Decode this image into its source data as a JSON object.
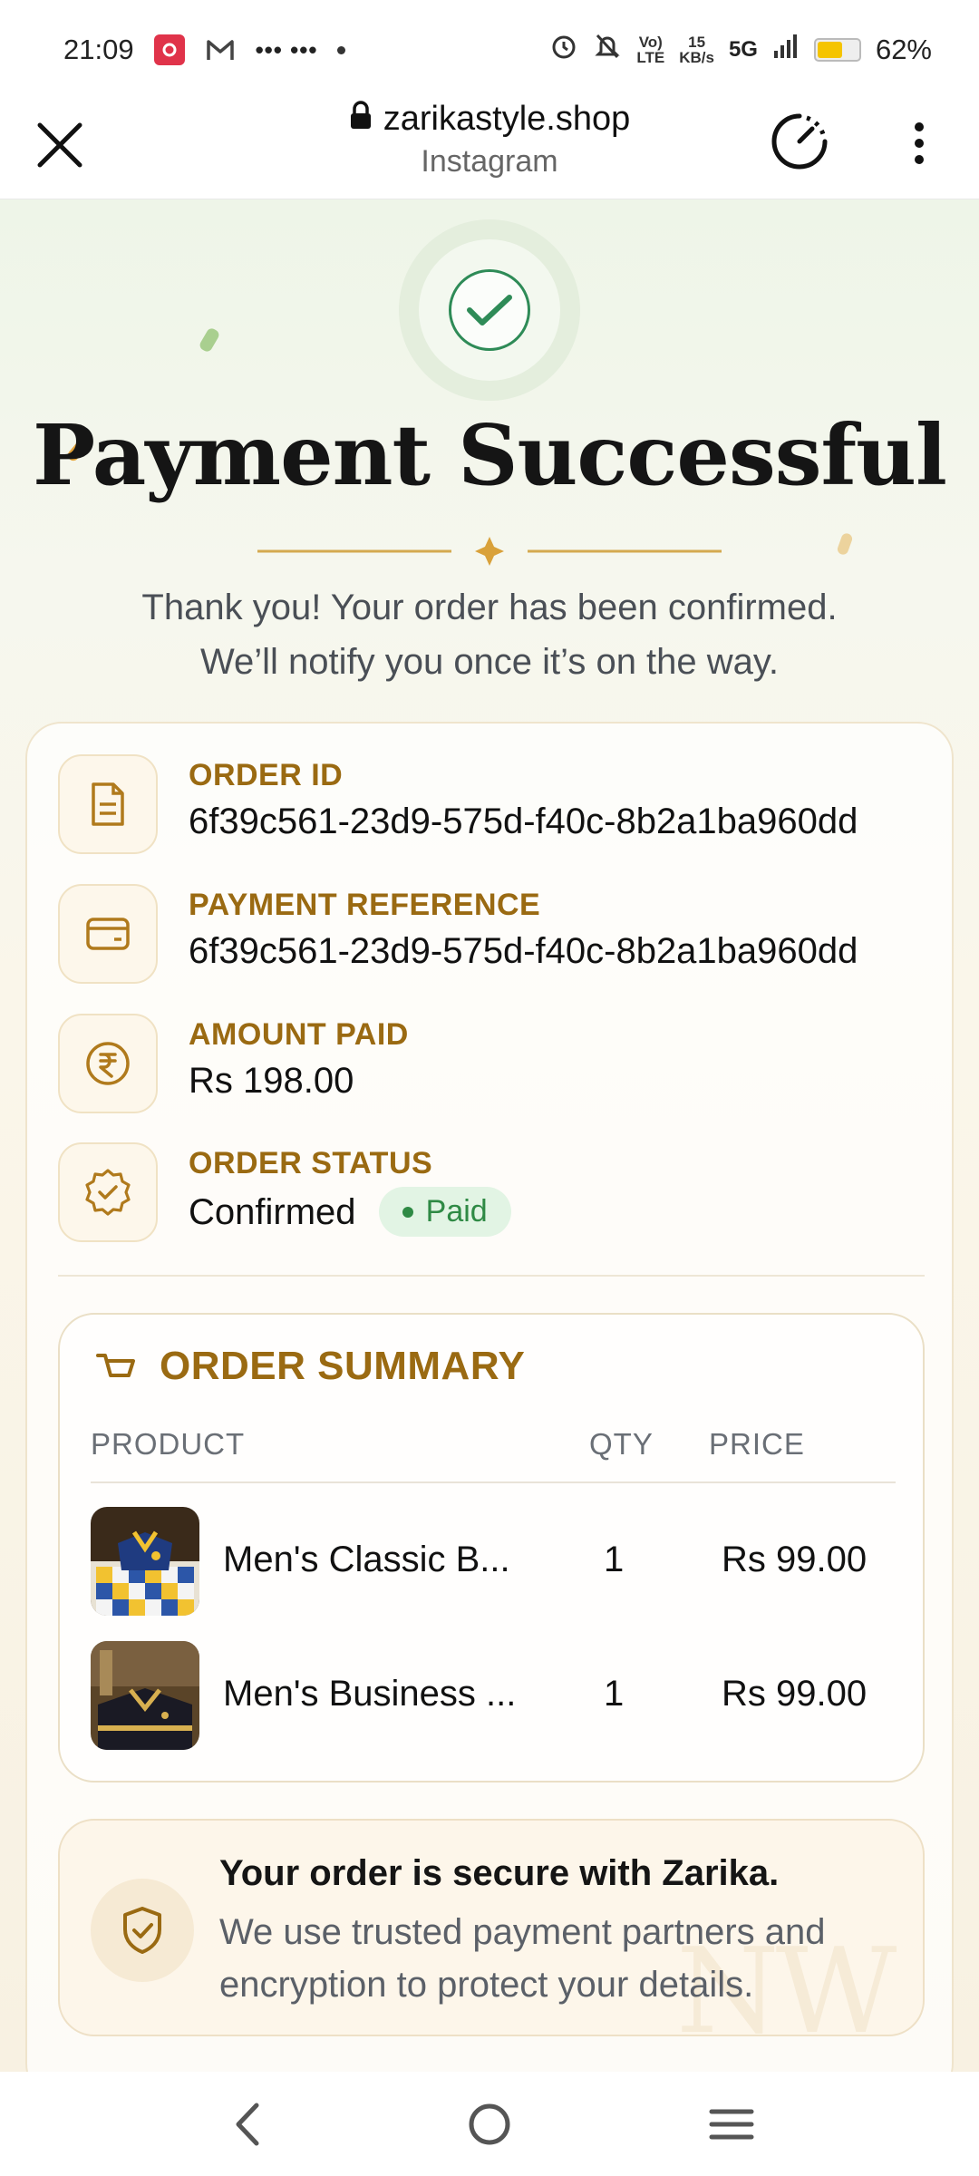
{
  "status_bar": {
    "time": "21:09",
    "network_rate_value": "15",
    "network_rate_unit": "KB/s",
    "volte_top": "Vo)",
    "volte_bottom": "LTE",
    "network_type": "5G",
    "battery_percent": "62%",
    "battery_level": 0.62,
    "icons": [
      "app-notification-icon",
      "gmail-icon",
      "more-notifications-icon",
      "alarm-icon",
      "mute-icon",
      "signal-icon",
      "battery-icon"
    ]
  },
  "browser": {
    "domain": "zarikastyle.shop",
    "subtitle": "Instagram",
    "icons": [
      "close-icon",
      "lock-icon",
      "page-speed-icon",
      "more-options-icon"
    ]
  },
  "page": {
    "title": "Payment Successful",
    "subtitle_line1": "Thank you! Your order has been confirmed.",
    "subtitle_line2": "We’ll notify you once it’s on the way."
  },
  "order": {
    "id_label": "ORDER ID",
    "id_value": "6f39c561-23d9-575d-f40c-8b2a1ba960dd",
    "ref_label": "PAYMENT REFERENCE",
    "ref_value": "6f39c561-23d9-575d-f40c-8b2a1ba960dd",
    "amount_label": "AMOUNT PAID",
    "amount_value": "Rs 198.00",
    "status_label": "ORDER STATUS",
    "status_value": "Confirmed",
    "status_badge": "Paid"
  },
  "summary": {
    "title": "ORDER SUMMARY",
    "columns": {
      "product": "PRODUCT",
      "qty": "QTY",
      "price": "PRICE"
    },
    "items": [
      {
        "name": "Men's Classic B...",
        "qty": "1",
        "price": "Rs 99.00"
      },
      {
        "name": "Men's Business ...",
        "qty": "1",
        "price": "Rs 99.00"
      }
    ]
  },
  "secure": {
    "title": "Your order is secure with Zarika.",
    "text": "We use trusted payment partners and encryption to protect your details.",
    "watermark": "NW"
  },
  "colors": {
    "accent_gold": "#9a6a12",
    "success_green": "#2f8a45",
    "background_tint": "#f6f7ee"
  }
}
